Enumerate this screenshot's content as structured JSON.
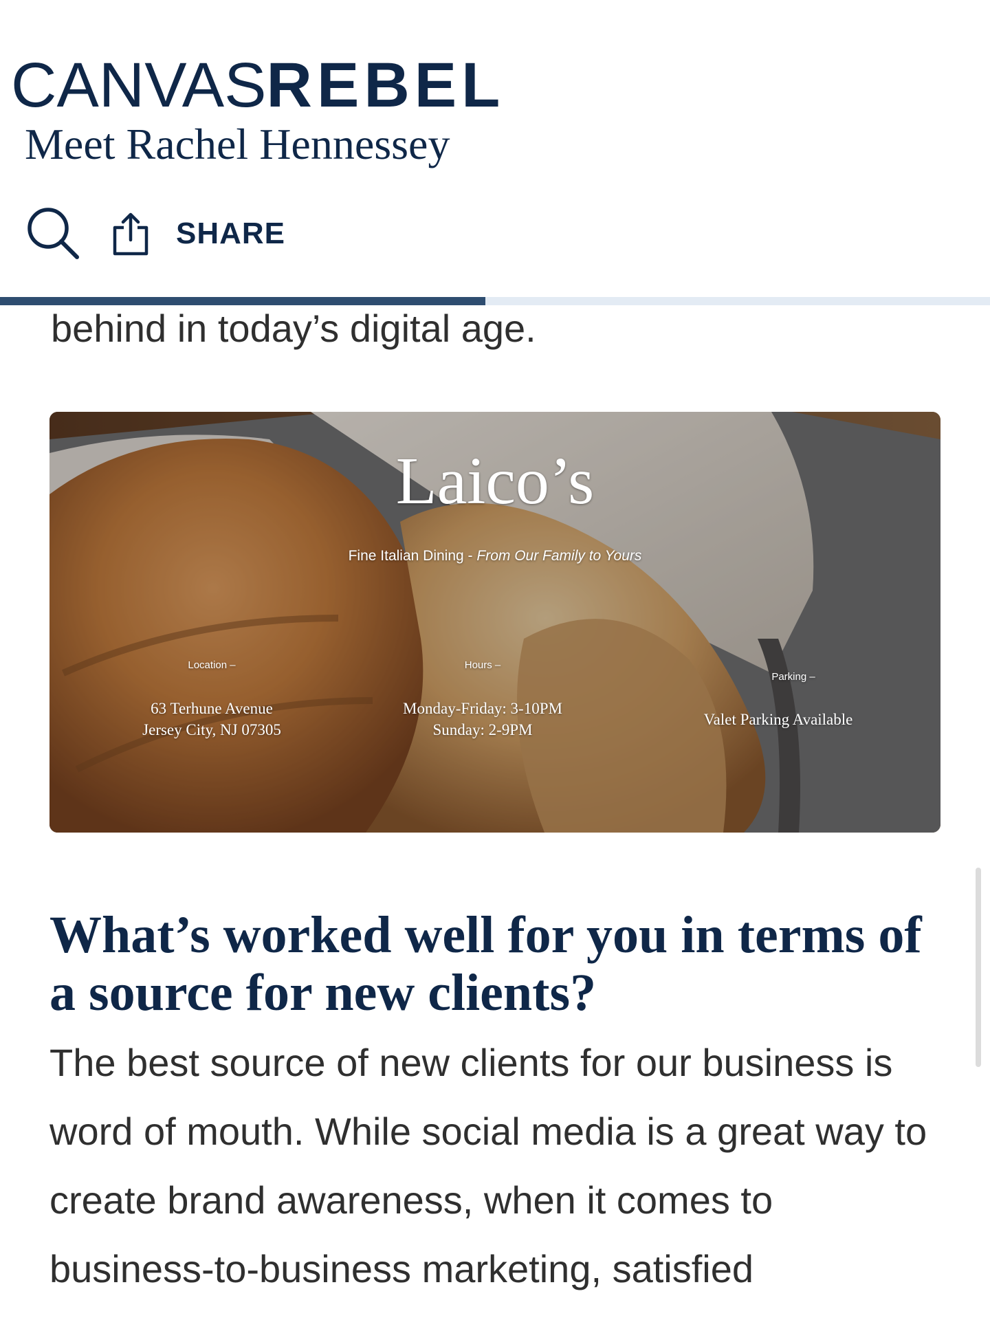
{
  "header": {
    "logo_thin": "CANVAS",
    "logo_bold": "REBEL",
    "subtitle": "Meet Rachel Hennessey",
    "share_label": "SHARE",
    "search_icon": "search-icon",
    "share_icon": "share-icon",
    "reading_progress": 0.49
  },
  "article": {
    "previous_text": "behind in today’s digital age.",
    "hero": {
      "title": "Laico’s",
      "tagline_plain": "Fine Italian Dining - ",
      "tagline_italic": "From Our Family to Yours",
      "location_label": "Location –",
      "location_line1": "63 Terhune Avenue",
      "location_line2": "Jersey City, NJ 07305",
      "hours_label": "Hours –",
      "hours_line1": "Monday-Friday: 3-10PM",
      "hours_line2": "Sunday: 2-9PM",
      "parking_label": "Parking –",
      "parking_line1": "Valet Parking Available"
    },
    "question": "What’s worked well for you in terms of a source for new clients?",
    "answer": "The best source of new clients for our business is word of mouth. While social media is a great way to create brand awareness, when it comes to business-to-business marketing, satisfied"
  },
  "colors": {
    "brand_navy": "#0f2748",
    "progress_fill": "#2e4d70",
    "progress_track": "#e3ebf4",
    "body_text": "#2f2f2f"
  }
}
